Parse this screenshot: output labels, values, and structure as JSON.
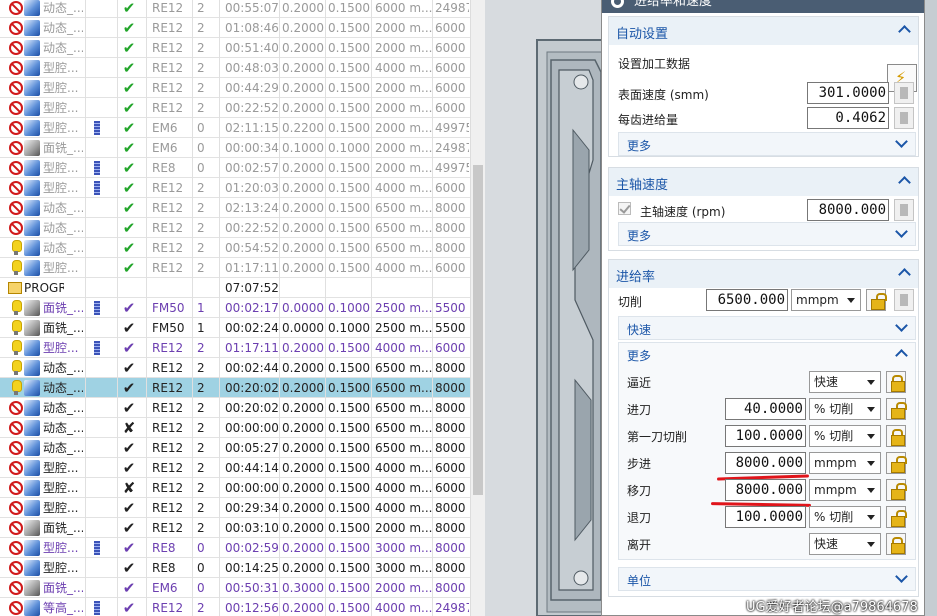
{
  "navigator": {
    "rows": [
      {
        "status": "nogo",
        "op": "blue",
        "name": "动态_...",
        "path": false,
        "check": "✔",
        "tool": "RE12",
        "tp": "2",
        "time": "00:55:07",
        "stepover": "0.2000",
        "depth": "0.1500",
        "feed": "6000 m...",
        "speed": "24987",
        "style": "gray"
      },
      {
        "status": "nogo",
        "op": "blue",
        "name": "动态_...",
        "path": false,
        "check": "✔",
        "tool": "RE12",
        "tp": "2",
        "time": "01:08:46",
        "stepover": "0.2000",
        "depth": "0.1500",
        "feed": "2000 m...",
        "speed": "6000",
        "style": "gray"
      },
      {
        "status": "nogo",
        "op": "blue",
        "name": "动态_...",
        "path": false,
        "check": "✔",
        "tool": "RE12",
        "tp": "2",
        "time": "00:51:40",
        "stepover": "0.2000",
        "depth": "0.1500",
        "feed": "2000 m...",
        "speed": "6000",
        "style": "gray"
      },
      {
        "status": "nogo",
        "op": "blue",
        "name": "型腔...",
        "path": false,
        "check": "✔",
        "tool": "RE12",
        "tp": "2",
        "time": "00:48:03",
        "stepover": "0.2000",
        "depth": "0.1500",
        "feed": "4000 m...",
        "speed": "6000",
        "style": "gray"
      },
      {
        "status": "nogo",
        "op": "blue",
        "name": "型腔...",
        "path": false,
        "check": "✔",
        "tool": "RE12",
        "tp": "2",
        "time": "00:44:29",
        "stepover": "0.2000",
        "depth": "0.1500",
        "feed": "2000 m...",
        "speed": "6000",
        "style": "gray"
      },
      {
        "status": "nogo",
        "op": "blue",
        "name": "型腔...",
        "path": false,
        "check": "✔",
        "tool": "RE12",
        "tp": "2",
        "time": "00:22:52",
        "stepover": "0.2000",
        "depth": "0.1500",
        "feed": "2000 m...",
        "speed": "6000",
        "style": "gray"
      },
      {
        "status": "nogo",
        "op": "blue",
        "name": "型腔...",
        "path": true,
        "check": "✔",
        "tool": "EM6",
        "tp": "0",
        "time": "02:11:15",
        "stepover": "0.2200",
        "depth": "0.1500",
        "feed": "2000 m...",
        "speed": "49975",
        "style": "gray"
      },
      {
        "status": "nogo",
        "op": "gray",
        "name": "面铣_...",
        "path": false,
        "check": "✔",
        "tool": "EM6",
        "tp": "0",
        "time": "00:00:34",
        "stepover": "0.1000",
        "depth": "0.1000",
        "feed": "2000 m...",
        "speed": "24987",
        "style": "gray"
      },
      {
        "status": "nogo",
        "op": "blue",
        "name": "型腔...",
        "path": true,
        "check": "✔",
        "tool": "RE8",
        "tp": "0",
        "time": "00:02:57",
        "stepover": "0.2000",
        "depth": "0.1500",
        "feed": "2000 m...",
        "speed": "49975",
        "style": "gray"
      },
      {
        "status": "nogo",
        "op": "blue",
        "name": "型腔...",
        "path": true,
        "check": "✔",
        "tool": "RE12",
        "tp": "2",
        "time": "01:20:03",
        "stepover": "0.2000",
        "depth": "0.1500",
        "feed": "4000 m...",
        "speed": "6000",
        "style": "gray"
      },
      {
        "status": "nogo",
        "op": "blue",
        "name": "动态_...",
        "path": false,
        "check": "✔",
        "tool": "RE12",
        "tp": "2",
        "time": "02:13:24",
        "stepover": "0.2000",
        "depth": "0.1500",
        "feed": "6500 m...",
        "speed": "8000",
        "style": "gray"
      },
      {
        "status": "nogo",
        "op": "blue",
        "name": "动态_...",
        "path": false,
        "check": "✔",
        "tool": "RE12",
        "tp": "2",
        "time": "00:22:52",
        "stepover": "0.2000",
        "depth": "0.1500",
        "feed": "6500 m...",
        "speed": "8000",
        "style": "gray"
      },
      {
        "status": "bulb",
        "op": "blue",
        "name": "动态_...",
        "path": false,
        "check": "✔",
        "tool": "RE12",
        "tp": "2",
        "time": "00:54:52",
        "stepover": "0.2000",
        "depth": "0.1500",
        "feed": "6500 m...",
        "speed": "8000",
        "style": "gray"
      },
      {
        "status": "bulb",
        "op": "blue",
        "name": "型腔...",
        "path": false,
        "check": "✔",
        "tool": "RE12",
        "tp": "2",
        "time": "01:17:11",
        "stepover": "0.2000",
        "depth": "0.1500",
        "feed": "4000 m...",
        "speed": "6000",
        "style": "gray"
      },
      {
        "status": "group",
        "op": "none",
        "name": "PROGR...",
        "path": false,
        "check": "",
        "tool": "",
        "tp": "",
        "time": "07:07:52",
        "stepover": "",
        "depth": "",
        "feed": "",
        "speed": "",
        "style": "dark"
      },
      {
        "status": "bulb",
        "op": "gray",
        "name": "面铣_...",
        "path": true,
        "check": "✔",
        "tool": "FM50",
        "tp": "1",
        "time": "00:02:17",
        "stepover": "0.0000",
        "depth": "0.1000",
        "feed": "2500 m...",
        "speed": "5500",
        "style": "purple"
      },
      {
        "status": "bulb",
        "op": "gray",
        "name": "面铣_...",
        "path": false,
        "check": "✔",
        "tool": "FM50",
        "tp": "1",
        "time": "00:02:24",
        "stepover": "0.0000",
        "depth": "0.1000",
        "feed": "2500 m...",
        "speed": "5500",
        "style": "dark"
      },
      {
        "status": "bulb",
        "op": "blue",
        "name": "型腔...",
        "path": true,
        "check": "✔",
        "tool": "RE12",
        "tp": "2",
        "time": "01:17:11",
        "stepover": "0.2000",
        "depth": "0.1500",
        "feed": "4000 m...",
        "speed": "6000",
        "style": "purple"
      },
      {
        "status": "bulb",
        "op": "blue",
        "name": "动态_...",
        "path": false,
        "check": "✔",
        "tool": "RE12",
        "tp": "2",
        "time": "00:02:44",
        "stepover": "0.2000",
        "depth": "0.1500",
        "feed": "6500 m...",
        "speed": "8000",
        "style": "dark"
      },
      {
        "status": "bulb",
        "op": "blue",
        "name": "动态_...",
        "path": false,
        "check": "✔",
        "tool": "RE12",
        "tp": "2",
        "time": "00:20:02",
        "stepover": "0.2000",
        "depth": "0.1500",
        "feed": "6500 m...",
        "speed": "8000",
        "style": "sel"
      },
      {
        "status": "nogo",
        "op": "blue",
        "name": "动态_...",
        "path": false,
        "check": "✔",
        "tool": "RE12",
        "tp": "2",
        "time": "00:20:02",
        "stepover": "0.2000",
        "depth": "0.1500",
        "feed": "6500 m...",
        "speed": "8000",
        "style": "dark"
      },
      {
        "status": "nogo",
        "op": "blue",
        "name": "动态_...",
        "path": false,
        "check": "✘",
        "tool": "RE12",
        "tp": "2",
        "time": "00:00:00",
        "stepover": "0.2000",
        "depth": "0.1500",
        "feed": "6500 m...",
        "speed": "8000",
        "style": "dark"
      },
      {
        "status": "nogo",
        "op": "blue",
        "name": "动态_...",
        "path": false,
        "check": "✔",
        "tool": "RE12",
        "tp": "2",
        "time": "00:05:27",
        "stepover": "0.2000",
        "depth": "0.1500",
        "feed": "6500 m...",
        "speed": "8000",
        "style": "dark"
      },
      {
        "status": "nogo",
        "op": "blue",
        "name": "型腔...",
        "path": false,
        "check": "✔",
        "tool": "RE12",
        "tp": "2",
        "time": "00:44:14",
        "stepover": "0.2000",
        "depth": "0.1500",
        "feed": "4000 m...",
        "speed": "6000",
        "style": "dark"
      },
      {
        "status": "nogo",
        "op": "blue",
        "name": "型腔...",
        "path": false,
        "check": "✘",
        "tool": "RE12",
        "tp": "2",
        "time": "00:00:00",
        "stepover": "0.2000",
        "depth": "0.1500",
        "feed": "4000 m...",
        "speed": "6000",
        "style": "dark"
      },
      {
        "status": "nogo",
        "op": "blue",
        "name": "型腔...",
        "path": false,
        "check": "✔",
        "tool": "RE12",
        "tp": "2",
        "time": "00:29:34",
        "stepover": "0.2000",
        "depth": "0.1500",
        "feed": "4000 m...",
        "speed": "8000",
        "style": "dark"
      },
      {
        "status": "nogo",
        "op": "gray",
        "name": "面铣_...",
        "path": false,
        "check": "✔",
        "tool": "RE12",
        "tp": "2",
        "time": "00:03:10",
        "stepover": "0.2000",
        "depth": "0.1500",
        "feed": "2000 m...",
        "speed": "8000",
        "style": "dark"
      },
      {
        "status": "nogo",
        "op": "blue",
        "name": "型腔...",
        "path": true,
        "check": "✔",
        "tool": "RE8",
        "tp": "0",
        "time": "00:02:59",
        "stepover": "0.2000",
        "depth": "0.1500",
        "feed": "3000 m...",
        "speed": "8000",
        "style": "purple"
      },
      {
        "status": "nogo",
        "op": "blue",
        "name": "型腔...",
        "path": false,
        "check": "✔",
        "tool": "RE8",
        "tp": "0",
        "time": "00:14:25",
        "stepover": "0.2000",
        "depth": "0.1500",
        "feed": "3000 m...",
        "speed": "8000",
        "style": "dark"
      },
      {
        "status": "nogo",
        "op": "gray",
        "name": "面铣_...",
        "path": false,
        "check": "✔",
        "tool": "EM6",
        "tp": "0",
        "time": "00:50:31",
        "stepover": "0.3000",
        "depth": "0.1500",
        "feed": "2000 m...",
        "speed": "8000",
        "style": "purple"
      },
      {
        "status": "nogo",
        "op": "blue",
        "name": "等高_...",
        "path": true,
        "check": "✔",
        "tool": "RE12",
        "tp": "2",
        "time": "00:12:56",
        "stepover": "0.2000",
        "depth": "0.1500",
        "feed": "4000 m...",
        "speed": "24987",
        "style": "purple"
      }
    ]
  },
  "dialog": {
    "title": "进给率和速度",
    "auto": {
      "title": "自动设置",
      "set_data_label": "设置加工数据",
      "surface_speed_label": "表面速度 (smm)",
      "surface_speed_value": "301.0000",
      "feed_per_tooth_label": "每齿进给量",
      "feed_per_tooth_value": "0.4062",
      "more_label": "更多"
    },
    "spindle": {
      "title": "主轴速度",
      "rpm_label": "主轴速度 (rpm)",
      "rpm_value": "8000.000",
      "more_label": "更多"
    },
    "feed": {
      "title": "进给率",
      "cut_label": "切削",
      "cut_value": "6500.000",
      "cut_unit": "mmpm",
      "rapid_label": "快速",
      "more_label": "更多",
      "approach_label": "逼近",
      "approach_unit": "快速",
      "engage_label": "进刀",
      "engage_value": "40.0000",
      "engage_unit": "% 切削",
      "first_cut_label": "第一刀切削",
      "first_cut_value": "100.0000",
      "first_cut_unit": "% 切削",
      "stepover_label": "步进",
      "stepover_value": "8000.000",
      "stepover_unit": "mmpm",
      "traversal_label": "移刀",
      "traversal_value": "8000.000",
      "traversal_unit": "mmpm",
      "retract_label": "退刀",
      "retract_value": "100.0000",
      "retract_unit": "% 切削",
      "departure_label": "离开",
      "departure_unit": "快速",
      "units_label": "单位"
    }
  },
  "watermark": "UG爱好者论坛@a79864678",
  "colors": {
    "title_bar": "#4a5d73",
    "section_title": "#1b56a8",
    "selected_row": "#9fd2e3",
    "purple_text": "#6c3fb0",
    "annotation_red": "#e0151b"
  }
}
